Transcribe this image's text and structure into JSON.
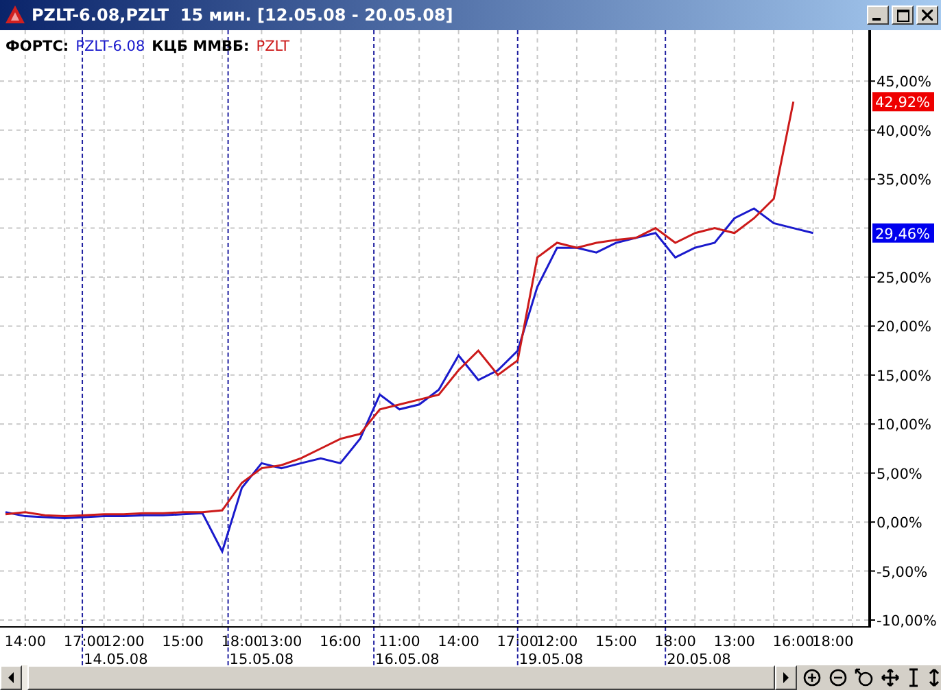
{
  "window": {
    "title": "PZLT-6.08,PZLT  15 мин. [12.05.08 - 20.05.08]"
  },
  "legend": [
    {
      "exchange": "ФОРТС:"
    },
    {
      "exchange": "КЦБ ММВБ:"
    }
  ],
  "chart_data": {
    "type": "line",
    "grid": true,
    "ylim": [
      -10.7,
      50.2
    ],
    "categories": [
      null,
      "14:00",
      null,
      null,
      "17:00",
      null,
      "12:00",
      null,
      null,
      "15:00",
      null,
      null,
      "18:00",
      null,
      "13:00",
      null,
      null,
      "16:00",
      null,
      null,
      "11:00",
      null,
      null,
      "14:00",
      null,
      null,
      "17:00",
      null,
      "12:00",
      null,
      null,
      "15:00",
      null,
      null,
      "18:00",
      null,
      null,
      "13:00",
      null,
      null,
      "16:00",
      null,
      "18:00"
    ],
    "series": [
      {
        "name": "PZLT-6.08",
        "color": "#1a1acc",
        "values": [
          1.0,
          0.6,
          0.5,
          0.4,
          0.5,
          0.6,
          0.6,
          0.7,
          0.7,
          0.8,
          0.9,
          -3.0,
          3.5,
          6.0,
          5.5,
          6.0,
          6.5,
          6.0,
          8.5,
          13.0,
          11.5,
          12.0,
          13.5,
          17.0,
          14.5,
          15.5,
          17.5,
          24.0,
          28.0,
          28.0,
          27.5,
          28.5,
          29.0,
          29.5,
          27.0,
          28.0,
          28.5,
          31.0,
          32.0,
          30.5,
          30.0,
          29.5,
          null
        ]
      },
      {
        "name": "PZLT",
        "color": "#cc1a1a",
        "values": [
          0.8,
          1.0,
          0.7,
          0.6,
          0.7,
          0.8,
          0.8,
          0.9,
          0.9,
          1.0,
          1.0,
          1.2,
          4.0,
          5.5,
          5.8,
          6.5,
          7.5,
          8.5,
          9.0,
          11.5,
          12.0,
          12.5,
          13.0,
          15.5,
          17.5,
          15.0,
          16.5,
          27.0,
          28.5,
          28.0,
          28.5,
          28.8,
          29.0,
          30.0,
          28.5,
          29.5,
          30.0,
          29.5,
          31.0,
          33.0,
          42.9,
          null,
          null
        ]
      }
    ],
    "yticks": [
      {
        "value": 45,
        "label": "45,00%"
      },
      {
        "value": 40,
        "label": "40,00%"
      },
      {
        "value": 35,
        "label": "35,00%"
      },
      {
        "value": 25,
        "label": "25,00%"
      },
      {
        "value": 20,
        "label": "20,00%"
      },
      {
        "value": 15,
        "label": "15,00%"
      },
      {
        "value": 10,
        "label": "10,00%"
      },
      {
        "value": 5,
        "label": "5,00%"
      },
      {
        "value": 0,
        "label": "0,00%"
      },
      {
        "value": -5,
        "label": "-5,00%"
      },
      {
        "value": -10,
        "label": "-10,00%"
      }
    ]
  },
  "date_labels": [
    "14.05.08",
    "15.05.08",
    "16.05.08",
    "19.05.08",
    "20.05.08"
  ],
  "last_value_badges": [
    {
      "label": "42,92%",
      "color": "#ee0000"
    },
    {
      "label": "29,46%",
      "color": "#0000ee"
    }
  ]
}
